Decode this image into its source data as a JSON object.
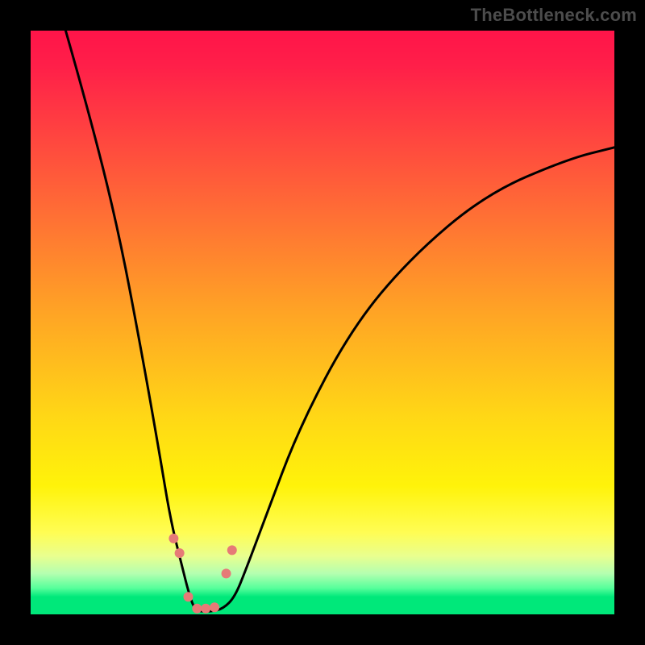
{
  "watermark": "TheBottleneck.com",
  "chart_data": {
    "type": "line",
    "title": "",
    "xlabel": "",
    "ylabel": "",
    "xlim": [
      0,
      100
    ],
    "ylim": [
      0,
      100
    ],
    "series": [
      {
        "name": "bottleneck-curve",
        "x": [
          6,
          10,
          15,
          19,
          22,
          24,
          26,
          27,
          28,
          29,
          31,
          33,
          35,
          37,
          40,
          46,
          55,
          65,
          78,
          92,
          100
        ],
        "values": [
          100,
          86,
          66,
          45,
          28,
          16,
          8,
          4,
          1,
          0.5,
          0.5,
          1,
          3,
          8,
          16,
          32,
          49,
          61,
          72,
          78,
          80
        ]
      }
    ],
    "markers": {
      "name": "scatter-points",
      "x": [
        24.5,
        25.5,
        27,
        28.5,
        30,
        31.5,
        33.5,
        34.5
      ],
      "y": [
        13,
        10.5,
        3,
        1,
        1,
        1.2,
        7,
        11
      ],
      "color": "#e67a77",
      "size": 12
    },
    "background_gradient": {
      "top": "#ff1449",
      "mid_upper": "#ffa325",
      "mid_lower": "#fff30a",
      "bottom": "#00e87a"
    }
  }
}
